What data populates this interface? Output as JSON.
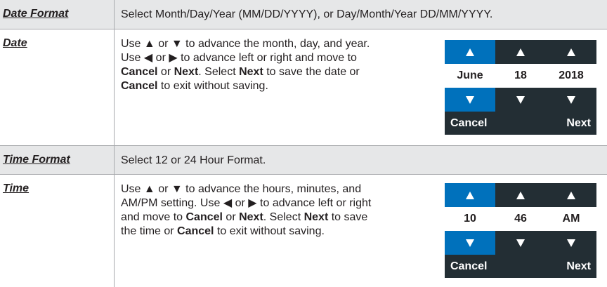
{
  "rows": [
    {
      "label": "Date Format",
      "description": "Select Month/Day/Year (MM/DD/YYYY), or Day/Month/Year DD/MM/YYYY."
    },
    {
      "label": "Date",
      "description_lines": [
        [
          "Use ",
          "▲",
          " or ",
          "▼",
          " to advance the month, day, and year."
        ],
        [
          "Use ",
          "◀",
          " or ",
          "▶",
          " to advance left or right and move to"
        ],
        [
          "Cancel",
          " or ",
          "Next",
          ".  Select ",
          "Next",
          " to save the date or"
        ],
        [
          "Cancel",
          " to exit without saving."
        ]
      ],
      "widget": {
        "values": [
          "June",
          "18",
          "2018"
        ],
        "cancel_label": "Cancel",
        "next_label": "Next"
      }
    },
    {
      "label": "Time Format",
      "description": "Select 12 or 24 Hour Format."
    },
    {
      "label": "Time",
      "description_lines": [
        [
          "Use ",
          "▲",
          " or ",
          "▼",
          " to advance the hours, minutes, and"
        ],
        [
          "AM/PM setting.  Use ",
          "◀",
          " or ",
          "▶",
          " to advance left or right"
        ],
        [
          "and move to ",
          "Cancel",
          " or ",
          "Next",
          ".  Select ",
          "Next",
          " to save"
        ],
        [
          "the time or ",
          "Cancel",
          " to exit without saving."
        ]
      ],
      "widget": {
        "values": [
          "10",
          "46",
          "AM"
        ],
        "cancel_label": "Cancel",
        "next_label": "Next"
      }
    }
  ],
  "colors": {
    "band": "#e6e7e8",
    "selected_blue": "#0071bc",
    "dark_panel": "#232e34",
    "rule": "#a7a9ac",
    "text": "#231f20"
  }
}
